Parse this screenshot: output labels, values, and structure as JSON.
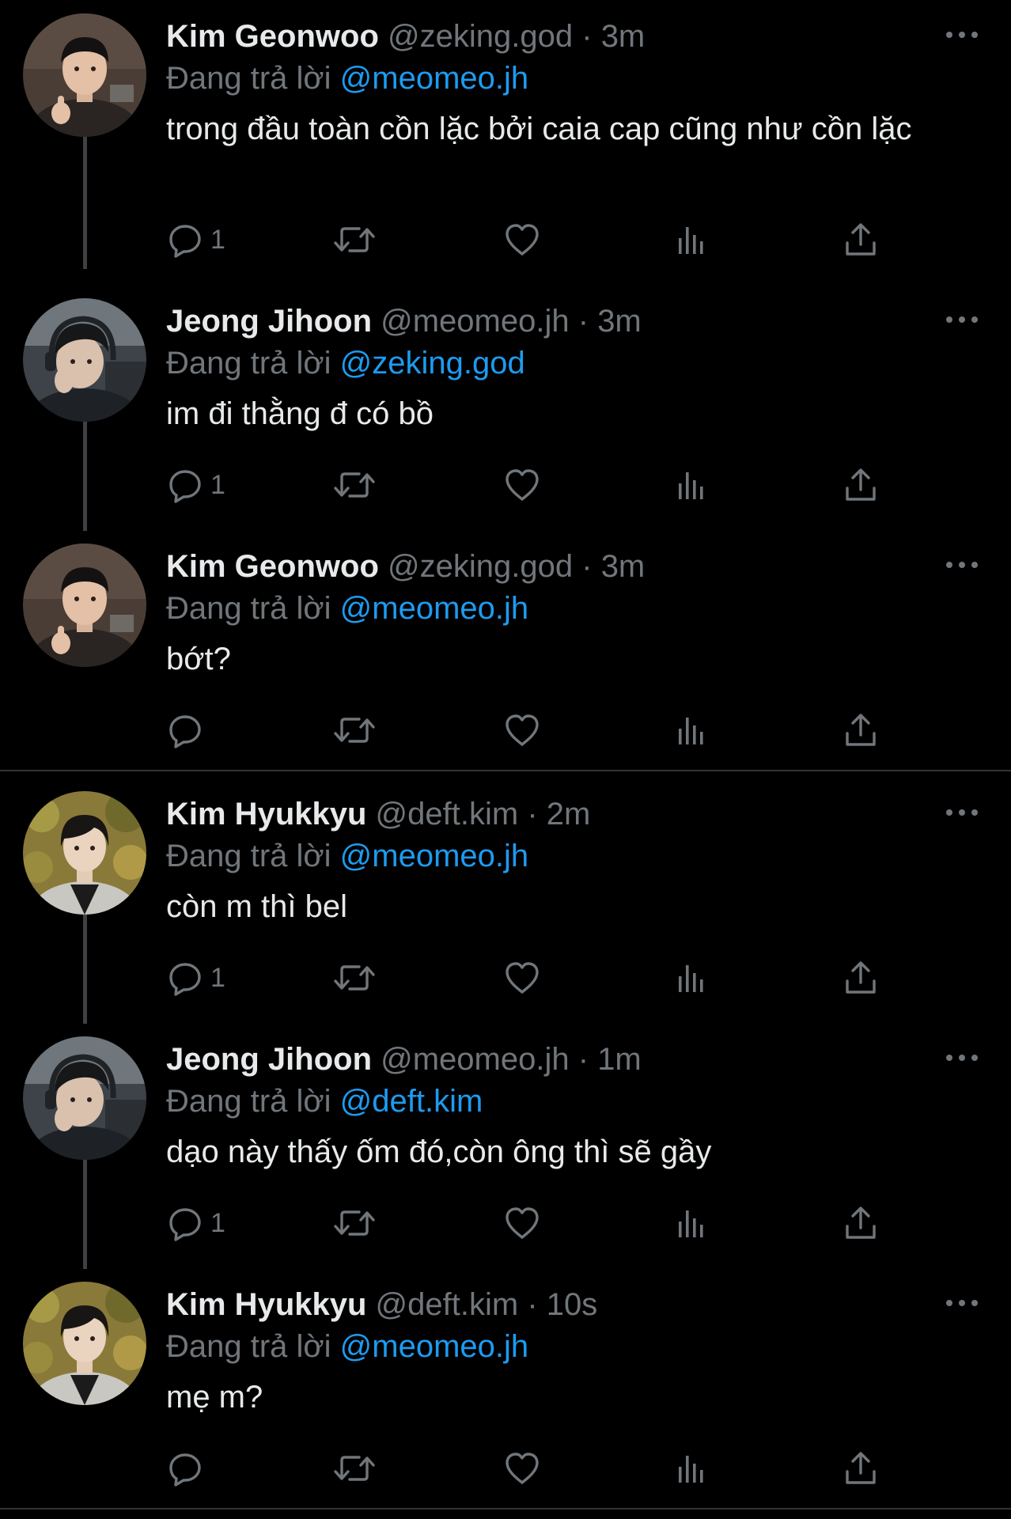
{
  "colors": {
    "background": "#000000",
    "name_text": "#e7e9ea",
    "secondary_text": "#71767b",
    "mention": "#1d9bf0",
    "thread_line": "#3e4144",
    "separator": "#2f3336"
  },
  "icons": {
    "reply": "reply-icon",
    "retweet": "retweet-icon",
    "like": "like-icon",
    "views": "views-icon",
    "share": "share-icon",
    "more": "more-icon"
  },
  "tweets": [
    {
      "name": "Kim Geonwoo",
      "handle": "@zeking.god",
      "dot": "·",
      "time": "3m",
      "reply_prefix": "Đang trả lời",
      "reply_to": "@meomeo.jh",
      "text": "trong đầu toàn cồn lặc bởi caia cap cũng như cồn lặc",
      "reply_count": "1"
    },
    {
      "name": "Jeong Jihoon",
      "handle": "@meomeo.jh",
      "dot": "·",
      "time": "3m",
      "reply_prefix": "Đang trả lời",
      "reply_to": "@zeking.god",
      "text": "im đi thằng đ có bồ",
      "reply_count": "1"
    },
    {
      "name": "Kim Geonwoo",
      "handle": "@zeking.god",
      "dot": "·",
      "time": "3m",
      "reply_prefix": "Đang trả lời",
      "reply_to": "@meomeo.jh",
      "text": "bớt?",
      "reply_count": ""
    },
    {
      "name": "Kim Hyukkyu",
      "handle": "@deft.kim",
      "dot": "·",
      "time": "2m",
      "reply_prefix": "Đang trả lời",
      "reply_to": "@meomeo.jh",
      "text": "còn m thì bel",
      "reply_count": "1"
    },
    {
      "name": "Jeong Jihoon",
      "handle": "@meomeo.jh",
      "dot": "·",
      "time": "1m",
      "reply_prefix": "Đang trả lời",
      "reply_to": "@deft.kim",
      "text": "dạo này thấy ốm đó,còn ông thì sẽ gầy",
      "reply_count": "1"
    },
    {
      "name": "Kim Hyukkyu",
      "handle": "@deft.kim",
      "dot": "·",
      "time": "10s",
      "reply_prefix": "Đang trả lời",
      "reply_to": "@meomeo.jh",
      "text": "mẹ m?",
      "reply_count": ""
    }
  ]
}
